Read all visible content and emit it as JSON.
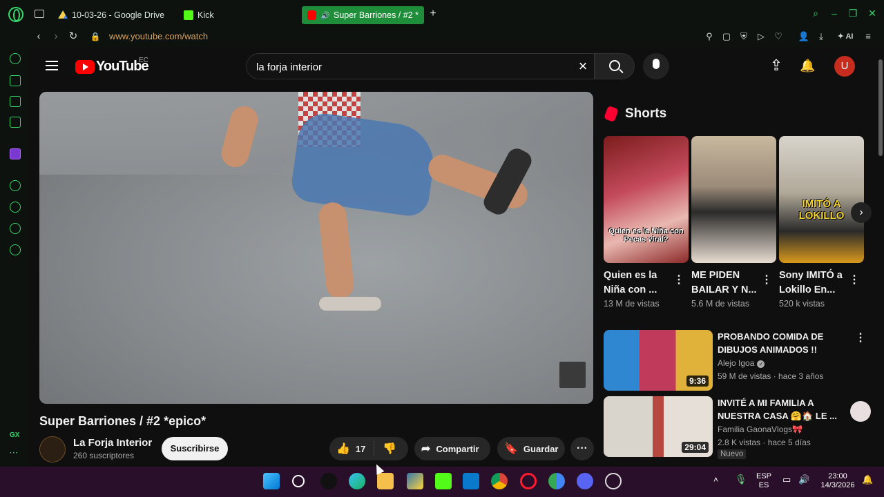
{
  "browser": {
    "tabs": [
      {
        "title": "10-03-26 - Google Drive",
        "active": false
      },
      {
        "title": "Kick",
        "active": false
      },
      {
        "title": "Super Barriones / #2 *",
        "active": true
      }
    ],
    "url": "www.youtube.com/watch",
    "ai_label": "AI",
    "sidebar_gx_label": "GX",
    "accent_color": "#39d86a"
  },
  "youtube": {
    "logo_text": "YouTube",
    "country_code": "EC",
    "search_value": "la forja interior",
    "avatar_letter": "U"
  },
  "video": {
    "title": "Super Barriones / #2 *epico*",
    "channel_name": "La Forja Interior",
    "subscribers": "260 suscriptores",
    "subscribe_label": "Suscribirse",
    "like_count": "17",
    "share_label": "Compartir",
    "save_label": "Guardar"
  },
  "shorts": {
    "heading": "Shorts",
    "items": [
      {
        "caption": "Quien es la Niña con Pecas viral?",
        "title": "Quien es la Niña con ...",
        "views": "13 M de vistas"
      },
      {
        "caption": "",
        "title": "ME PIDEN BAILAR Y N...",
        "views": "5.6 M de vistas"
      },
      {
        "caption": "IMITÓ A LOKILLO",
        "title": "Sony IMITÓ a Lokillo En...",
        "views": "520 k vistas"
      }
    ]
  },
  "recommendations": [
    {
      "title": "PROBANDO COMIDA DE DIBUJOS ANIMADOS !!",
      "channel": "Alejo Igoa",
      "verified": true,
      "meta": "59 M de vistas · hace 3 años",
      "duration": "9:36",
      "badge": ""
    },
    {
      "title": "INVITÉ A MI FAMILIA A NUESTRA CASA 🤗🏠 LE ...",
      "channel": "Familia GaonaVlogs🎀",
      "verified": false,
      "meta": "2.8 K vistas · hace 5 días",
      "duration": "29:04",
      "badge": "Nuevo"
    }
  ],
  "taskbar": {
    "lang_line1": "ESP",
    "lang_line2": "ES",
    "time": "23:00",
    "date": "14/3/2026"
  }
}
